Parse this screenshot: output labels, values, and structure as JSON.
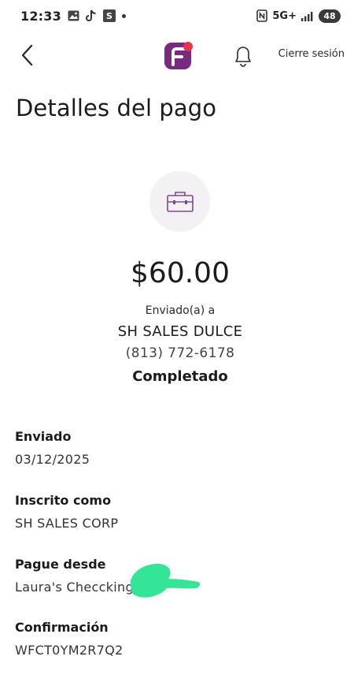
{
  "status_bar": {
    "time": "12:33",
    "s_badge": "S",
    "network": "5G+",
    "battery": "48"
  },
  "header": {
    "logout_label": "Cierre sesión",
    "brand_color": "#7a2a7e",
    "brand_accent": "#e8334a"
  },
  "page": {
    "title": "Detalles del pago"
  },
  "payment": {
    "amount": "$60.00",
    "sent_to_label": "Enviado(a) a",
    "recipient_name": "SH SALES DULCE",
    "recipient_phone": "(813) 772-6178",
    "status": "Completado"
  },
  "details": [
    {
      "label": "Enviado",
      "value": "03/12/2025"
    },
    {
      "label": "Inscrito como",
      "value": "SH SALES CORP"
    },
    {
      "label": "Pague desde",
      "value": "Laura's Checcking ."
    },
    {
      "label": "Confirmación",
      "value": "WFCT0YM2R7Q2"
    }
  ],
  "icons": {
    "back": "chevron-left-icon",
    "bell": "bell-icon",
    "payment_type": "briefcase-icon"
  },
  "colors": {
    "icon_circle_bg": "#f3f1f3",
    "briefcase": "#7b4a99",
    "redaction": "#34e597"
  }
}
